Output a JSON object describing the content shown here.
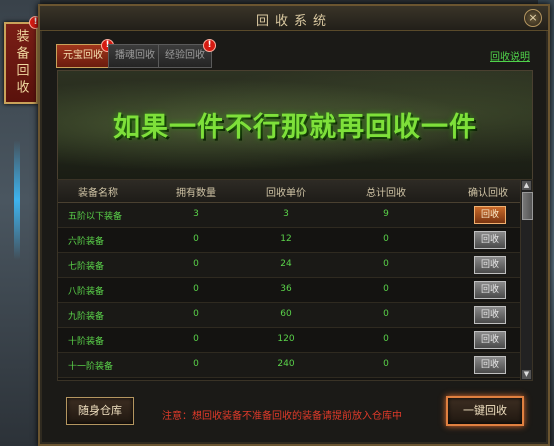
{
  "side_tab": {
    "label": "装备回收",
    "alert": "!"
  },
  "window": {
    "title": "回收系统",
    "close_symbol": "×"
  },
  "tabs": [
    {
      "label": "元宝回收",
      "active": true,
      "alert": "!"
    },
    {
      "label": "播魂回收",
      "active": false,
      "alert": ""
    },
    {
      "label": "经验回收",
      "active": false,
      "alert": "!"
    }
  ],
  "help_link": "回收说明",
  "banner_text": "如果一件不行那就再回收一件",
  "table": {
    "headers": [
      "装备名称",
      "拥有数量",
      "回收单价",
      "总计回收",
      "确认回收"
    ],
    "rows": [
      {
        "name": "五阶以下装备",
        "owned": "3",
        "price": "3",
        "total": "9",
        "button": "回收",
        "enabled": true
      },
      {
        "name": "六阶装备",
        "owned": "0",
        "price": "12",
        "total": "0",
        "button": "回收",
        "enabled": false
      },
      {
        "name": "七阶装备",
        "owned": "0",
        "price": "24",
        "total": "0",
        "button": "回收",
        "enabled": false
      },
      {
        "name": "八阶装备",
        "owned": "0",
        "price": "36",
        "total": "0",
        "button": "回收",
        "enabled": false
      },
      {
        "name": "九阶装备",
        "owned": "0",
        "price": "60",
        "total": "0",
        "button": "回收",
        "enabled": false
      },
      {
        "name": "十阶装备",
        "owned": "0",
        "price": "120",
        "total": "0",
        "button": "回收",
        "enabled": false
      },
      {
        "name": "十一阶装备",
        "owned": "0",
        "price": "240",
        "total": "0",
        "button": "回收",
        "enabled": false
      }
    ]
  },
  "footer": {
    "warehouse_button": "随身仓库",
    "notice": "注意：想回收装备不准备回收的装备请提前放入仓库中",
    "recycle_all_button": "一键回收"
  },
  "colors": {
    "accent_green": "#5ad24a",
    "warning_red": "#e03a2a",
    "border_gold": "#b49660"
  }
}
